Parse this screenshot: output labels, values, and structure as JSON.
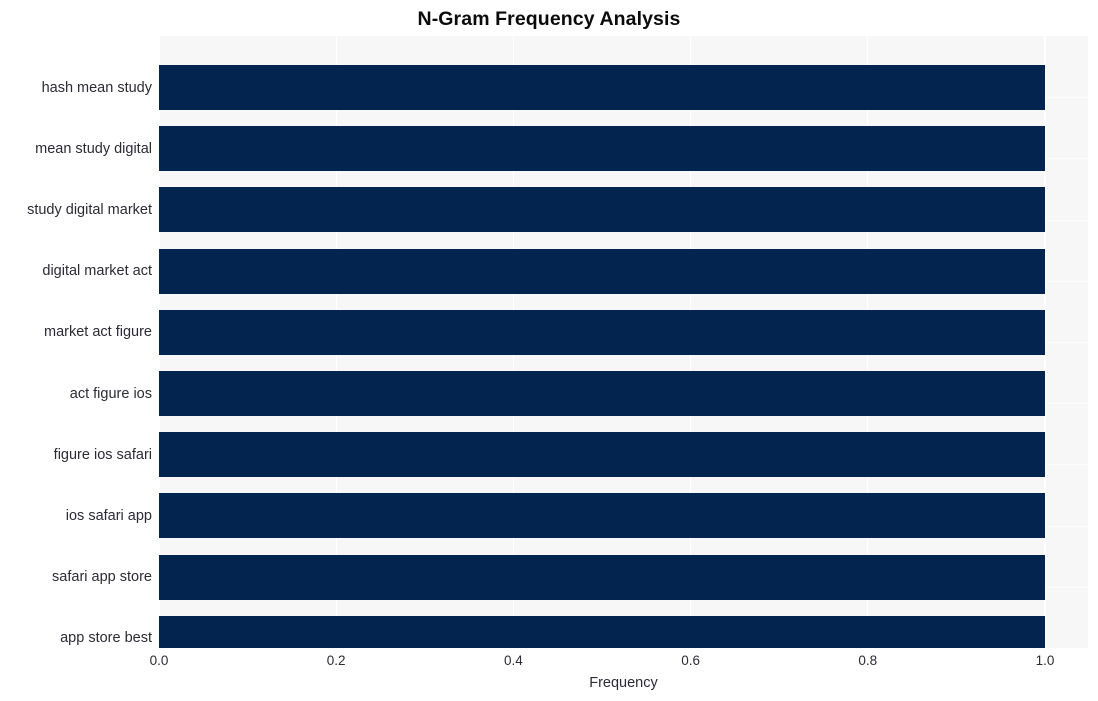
{
  "chart_data": {
    "type": "bar",
    "orientation": "horizontal",
    "title": "N-Gram Frequency Analysis",
    "xlabel": "Frequency",
    "ylabel": "",
    "categories": [
      "hash mean study",
      "mean study digital",
      "study digital market",
      "digital market act",
      "market act figure",
      "act figure ios",
      "figure ios safari",
      "ios safari app",
      "safari app store",
      "app store best"
    ],
    "values": [
      1.0,
      1.0,
      1.0,
      1.0,
      1.0,
      1.0,
      1.0,
      1.0,
      1.0,
      1.0
    ],
    "xlim": [
      0.0,
      1.0
    ],
    "xticks": [
      0.0,
      0.2,
      0.4,
      0.6,
      0.8,
      1.0
    ],
    "xtick_labels": [
      "0.0",
      "0.2",
      "0.4",
      "0.6",
      "0.8",
      "1.0"
    ],
    "grid": true,
    "legend": null,
    "bar_color": "#03244f",
    "plot_background": "#f7f7f7",
    "gridline_color": "#ffffff",
    "figure_background": "#ffffff",
    "title_color": "#0b0b0b",
    "tick_label_color": "#2b2b35"
  }
}
